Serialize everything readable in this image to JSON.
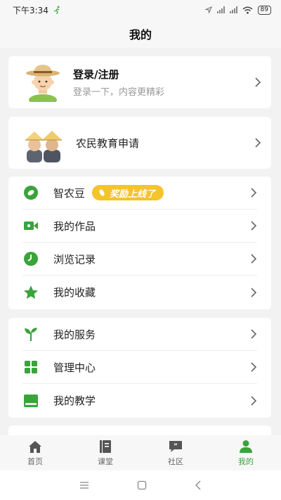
{
  "status_bar": {
    "time": "下午3:34",
    "battery": "89"
  },
  "header": {
    "title": "我的"
  },
  "login": {
    "title": "登录/注册",
    "subtitle": "登录一下，内容更精彩"
  },
  "farmer_edu": {
    "label": "农民教育申请"
  },
  "menu_group_1": [
    {
      "label": "智农豆",
      "icon": "bean-icon",
      "promo": "奖励上线了"
    },
    {
      "label": "我的作品",
      "icon": "video-icon"
    },
    {
      "label": "浏览记录",
      "icon": "clock-icon"
    },
    {
      "label": "我的收藏",
      "icon": "star-icon"
    }
  ],
  "menu_group_2": [
    {
      "label": "我的服务",
      "icon": "sprout-icon"
    },
    {
      "label": "管理中心",
      "icon": "grid-icon"
    },
    {
      "label": "我的教学",
      "icon": "book-icon"
    }
  ],
  "tabs": [
    {
      "label": "首页",
      "icon": "home-icon"
    },
    {
      "label": "课堂",
      "icon": "classroom-icon"
    },
    {
      "label": "社区",
      "icon": "community-icon"
    },
    {
      "label": "我的",
      "icon": "profile-icon",
      "active": true
    }
  ],
  "colors": {
    "accent": "#3aa33a",
    "promo": "#f5c32b",
    "background": "#f2f2f2"
  }
}
